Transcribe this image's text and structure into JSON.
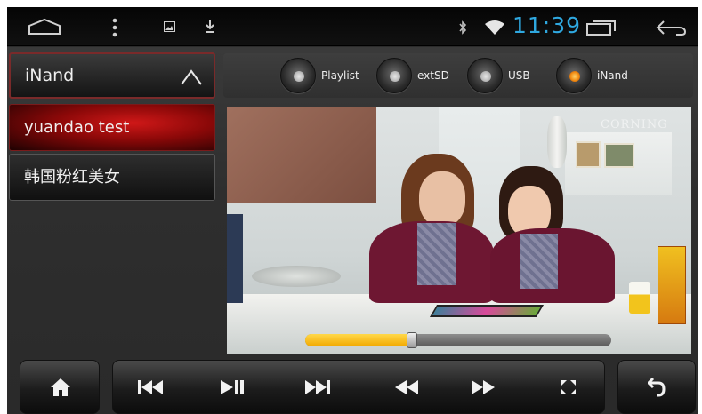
{
  "status_bar": {
    "clock": "11:39",
    "icons": [
      "home-outline-icon",
      "overflow-menu-icon",
      "image-icon",
      "download-icon",
      "bluetooth-icon",
      "wifi-icon",
      "recent-apps-icon",
      "back-arrow-icon"
    ]
  },
  "source_panel": {
    "current_source": "iNand",
    "files": [
      {
        "name": "yuandao test",
        "active": true
      },
      {
        "name": "韩国粉红美女",
        "active": false
      }
    ]
  },
  "source_buttons": [
    {
      "label": "Playlist",
      "on": false
    },
    {
      "label": "extSD",
      "on": false
    },
    {
      "label": "USB",
      "on": false
    },
    {
      "label": "iNand",
      "on": true
    }
  ],
  "video": {
    "watermark": "CORNING",
    "progress_fraction": 0.35
  },
  "controls": {
    "icons": [
      "home-icon",
      "previous-track-icon",
      "play-pause-icon",
      "next-track-icon",
      "rewind-icon",
      "fast-forward-icon",
      "fullscreen-icon",
      "return-icon"
    ]
  },
  "colors": {
    "clock": "#2fa8e0",
    "active_item": "#c41010",
    "progress": "#f5b800",
    "active_source_dot": "#f08b12"
  }
}
